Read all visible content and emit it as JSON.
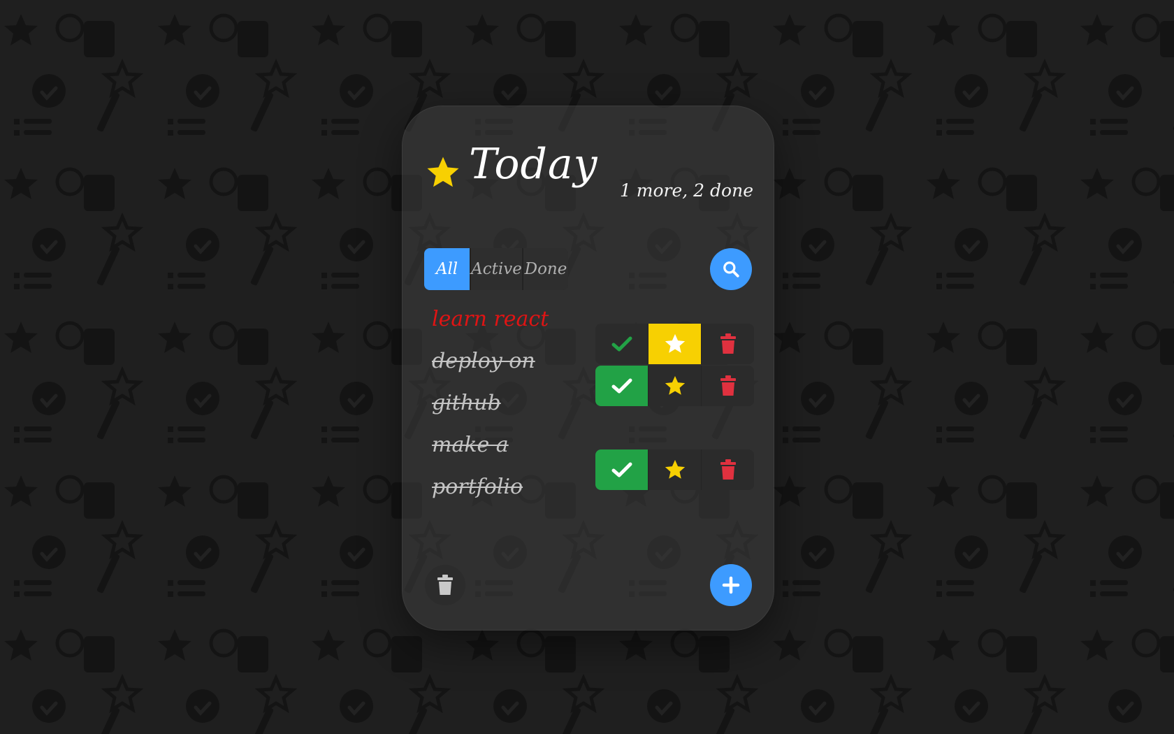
{
  "header": {
    "title": "Today",
    "summary": "1 more, 2 done",
    "icon": "star-icon"
  },
  "filters": {
    "tabs": [
      {
        "label": "All",
        "active": true
      },
      {
        "label": "Active",
        "active": false
      },
      {
        "label": "Done",
        "active": false
      }
    ],
    "search_icon": "search-icon"
  },
  "todos": [
    {
      "text": "learn react",
      "done": false,
      "starred": true
    },
    {
      "text": "deploy on github",
      "done": true,
      "starred": false
    },
    {
      "text": "make a portfolio",
      "done": true,
      "starred": false
    }
  ],
  "footer": {
    "clear_icon": "trash-icon",
    "add_icon": "plus-icon"
  },
  "colors": {
    "accent": "#3d9bff",
    "success": "#22a246",
    "star": "#f7d002",
    "danger": "#e0313f",
    "important_text": "#e01414",
    "background": "#1f1f1f"
  }
}
